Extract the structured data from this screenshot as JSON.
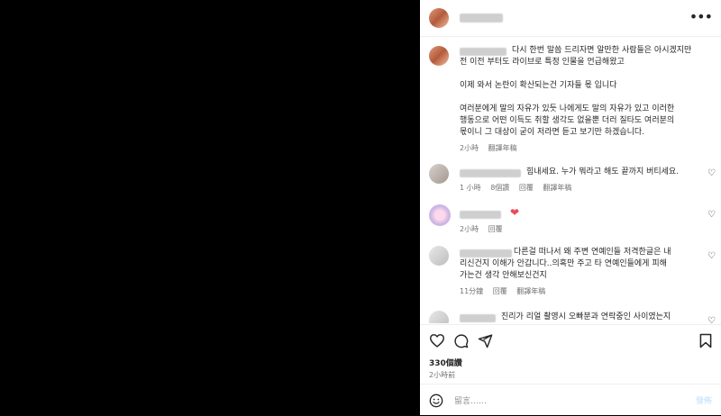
{
  "header": {
    "more_label": "•••"
  },
  "caption": {
    "text_line1": "다시 한번 말씀 드리자면 알만한 사람들은 아시겠지만",
    "text_line2": "전 이전 부터도 라이브로 특정 인물을 언급해왔고",
    "text_line3": "이제 와서 논란이 확산되는건 기자들 몫 입니다",
    "text_line4": "여러분에게 말의 자유가 있듯 나에게도 말의 자유가 있고 이러한",
    "text_line5": "행동으로 어떤 이득도 취할 생각도 없을뿐 더러 질타도 여러분의",
    "text_line6": "몫이니 그 대상이 굳이 저라면 듣고 보기만 하겠습니다.",
    "time": "2小時",
    "translate": "翻譯年稿"
  },
  "comments": [
    {
      "text": "힘내세요. 누가 뭐라고 해도 끝까지 버티세요.",
      "time": "1 小時",
      "likes": "8個讚",
      "reply": "回覆",
      "translate": "翻譯年稿"
    },
    {
      "time": "2小時",
      "reply": "回覆"
    },
    {
      "text_line1": "다른걸 떠나서 왜 주변 연예인들 저격한글은 내",
      "text_line2": "리신건지 이해가 안갑니다..의혹만 주고 타 연예인들에게 피해",
      "text_line3": "가는건 생각 안해보신건지",
      "time": "11分鐘",
      "reply": "回覆",
      "translate": "翻譯年稿"
    },
    {
      "text": "진리가 리얼 촬영시 오빠분과 연락중인 사이였는지"
    }
  ],
  "footer": {
    "likes": "330個讚",
    "time": "2小時前",
    "comment_placeholder": "留言……",
    "post_label": "發佈"
  },
  "colors": {
    "heart_red": "#ed4956",
    "muted": "#737373"
  }
}
